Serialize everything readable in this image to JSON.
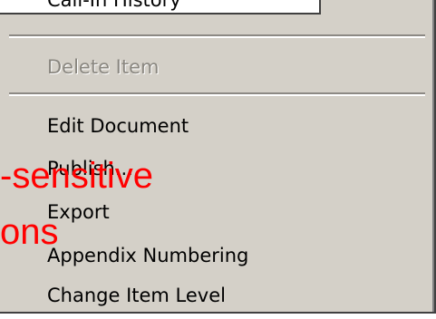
{
  "menu": {
    "items": [
      {
        "label": "Call-In History",
        "disabled": false
      },
      {
        "label": "Delete Item",
        "disabled": true
      },
      {
        "label": "Edit Document",
        "disabled": false
      },
      {
        "label": "Publish...",
        "disabled": false
      },
      {
        "label": "Export",
        "disabled": false
      },
      {
        "label": "Appendix Numbering",
        "disabled": false
      },
      {
        "label": "Change Item Level",
        "disabled": false
      }
    ]
  },
  "overlay": {
    "line1": "-sensitive",
    "line2": "ons"
  },
  "colors": {
    "menu_background": "#d4d0c8",
    "disabled_text": "#8a8780",
    "overlay_text": "#ff0000"
  }
}
